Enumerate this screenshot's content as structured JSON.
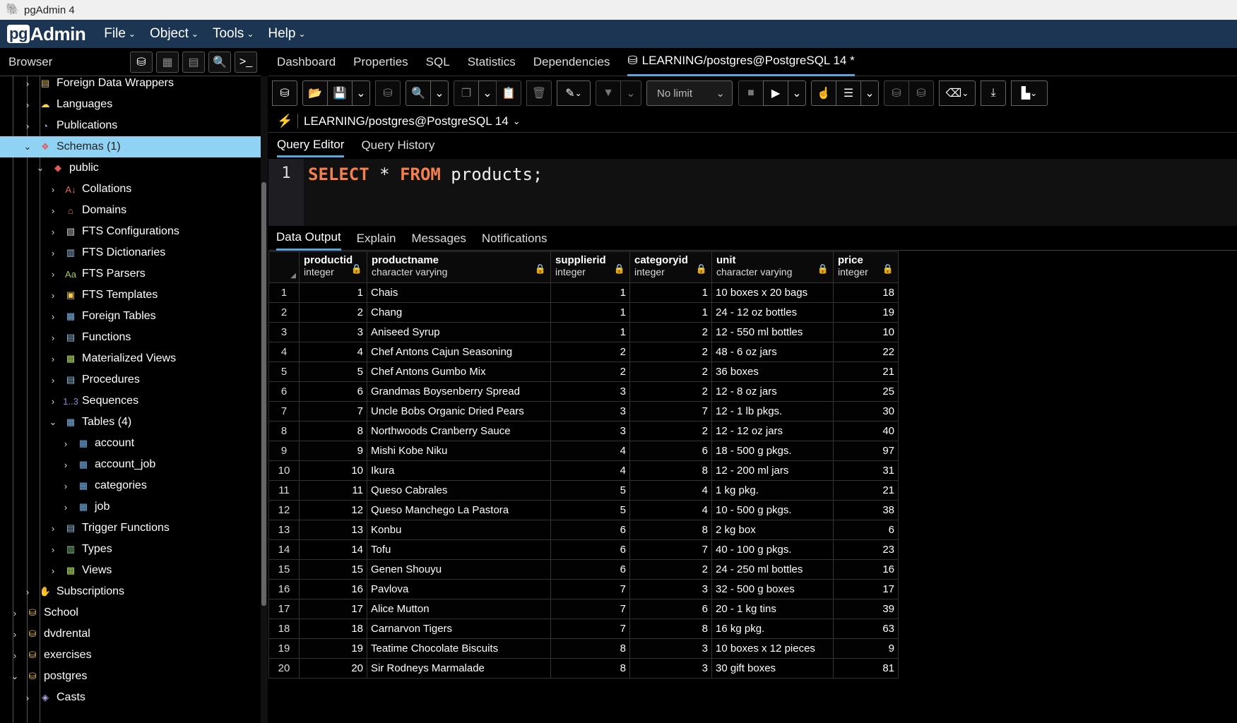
{
  "window": {
    "title": "pgAdmin 4"
  },
  "menubar": {
    "logo_pg": "pg",
    "logo_admin": "Admin",
    "items": [
      "File",
      "Object",
      "Tools",
      "Help"
    ]
  },
  "browser": {
    "title": "Browser",
    "tree": [
      {
        "label": "Foreign Data Wrappers",
        "indent": 2,
        "expanded": false,
        "icon": "foreign-data-wrapper-icon",
        "glyph": "▤",
        "color": "#e8c34a"
      },
      {
        "label": "Languages",
        "indent": 2,
        "expanded": false,
        "icon": "language-icon",
        "glyph": "☁",
        "color": "#f2d64b"
      },
      {
        "label": "Publications",
        "indent": 2,
        "expanded": false,
        "icon": "publication-icon",
        "glyph": "◔",
        "color": "#9fb6d9"
      },
      {
        "label": "Schemas (1)",
        "indent": 2,
        "expanded": true,
        "icon": "schemas-icon",
        "glyph": "❖",
        "color": "#e05a5a",
        "selected": true
      },
      {
        "label": "public",
        "indent": 3,
        "expanded": true,
        "icon": "schema-icon",
        "glyph": "◆",
        "color": "#e05a5a"
      },
      {
        "label": "Collations",
        "indent": 4,
        "expanded": false,
        "icon": "collation-icon",
        "glyph": "A↓",
        "color": "#e06b6b"
      },
      {
        "label": "Domains",
        "indent": 4,
        "expanded": false,
        "icon": "domain-icon",
        "glyph": "⌂",
        "color": "#e67a7a"
      },
      {
        "label": "FTS Configurations",
        "indent": 4,
        "expanded": false,
        "icon": "fts-configuration-icon",
        "glyph": "▧",
        "color": "#cccccc"
      },
      {
        "label": "FTS Dictionaries",
        "indent": 4,
        "expanded": false,
        "icon": "fts-dictionary-icon",
        "glyph": "▥",
        "color": "#9fc3e8"
      },
      {
        "label": "FTS Parsers",
        "indent": 4,
        "expanded": false,
        "icon": "fts-parser-icon",
        "glyph": "Aa",
        "color": "#a7c94a"
      },
      {
        "label": "FTS Templates",
        "indent": 4,
        "expanded": false,
        "icon": "fts-template-icon",
        "glyph": "▣",
        "color": "#f2c94b"
      },
      {
        "label": "Foreign Tables",
        "indent": 4,
        "expanded": false,
        "icon": "foreign-table-icon",
        "glyph": "▦",
        "color": "#7fb5e8"
      },
      {
        "label": "Functions",
        "indent": 4,
        "expanded": false,
        "icon": "function-icon",
        "glyph": "▤",
        "color": "#8fc3e0"
      },
      {
        "label": "Materialized Views",
        "indent": 4,
        "expanded": false,
        "icon": "materialized-view-icon",
        "glyph": "▩",
        "color": "#a8d65a"
      },
      {
        "label": "Procedures",
        "indent": 4,
        "expanded": false,
        "icon": "procedure-icon",
        "glyph": "▤",
        "color": "#8fc3e0"
      },
      {
        "label": "Sequences",
        "indent": 4,
        "expanded": false,
        "icon": "sequence-icon",
        "glyph": "1..3",
        "color": "#8a8ad0"
      },
      {
        "label": "Tables (4)",
        "indent": 4,
        "expanded": true,
        "icon": "tables-icon",
        "glyph": "▦",
        "color": "#7fb5e8"
      },
      {
        "label": "account",
        "indent": 5,
        "expanded": false,
        "icon": "table-icon",
        "glyph": "▦",
        "color": "#6fb0ea"
      },
      {
        "label": "account_job",
        "indent": 5,
        "expanded": false,
        "icon": "table-icon",
        "glyph": "▦",
        "color": "#6fb0ea"
      },
      {
        "label": "categories",
        "indent": 5,
        "expanded": false,
        "icon": "table-icon",
        "glyph": "▦",
        "color": "#6fb0ea"
      },
      {
        "label": "job",
        "indent": 5,
        "expanded": false,
        "icon": "table-icon",
        "glyph": "▦",
        "color": "#6fb0ea"
      },
      {
        "label": "Trigger Functions",
        "indent": 4,
        "expanded": false,
        "icon": "trigger-function-icon",
        "glyph": "▤",
        "color": "#8fc3e0"
      },
      {
        "label": "Types",
        "indent": 4,
        "expanded": false,
        "icon": "type-icon",
        "glyph": "▥",
        "color": "#8fd69a"
      },
      {
        "label": "Views",
        "indent": 4,
        "expanded": false,
        "icon": "view-icon",
        "glyph": "▩",
        "color": "#a8d65a"
      },
      {
        "label": "Subscriptions",
        "indent": 2,
        "expanded": false,
        "icon": "subscription-icon",
        "glyph": "✋",
        "color": "#f2c94b"
      },
      {
        "label": "School",
        "indent": 1,
        "expanded": false,
        "icon": "database-icon",
        "glyph": "⛁",
        "color": "#e8c34a"
      },
      {
        "label": "dvdrental",
        "indent": 1,
        "expanded": false,
        "icon": "database-icon",
        "glyph": "⛁",
        "color": "#e8c34a"
      },
      {
        "label": "exercises",
        "indent": 1,
        "expanded": false,
        "icon": "database-icon",
        "glyph": "⛁",
        "color": "#e8c34a"
      },
      {
        "label": "postgres",
        "indent": 1,
        "expanded": true,
        "icon": "database-icon",
        "glyph": "⛁",
        "color": "#e8c34a"
      },
      {
        "label": "Casts",
        "indent": 2,
        "expanded": false,
        "icon": "cast-icon",
        "glyph": "◈",
        "color": "#b9a2e8"
      }
    ]
  },
  "main": {
    "tabs": [
      "Dashboard",
      "Properties",
      "SQL",
      "Statistics",
      "Dependencies"
    ],
    "active_tab": "LEARNING/postgres@PostgreSQL 14 *",
    "row_limit": "No limit",
    "connection": "LEARNING/postgres@PostgreSQL 14",
    "query_tabs": [
      "Query Editor",
      "Query History"
    ],
    "editor": {
      "line_number": "1",
      "kw1": "SELECT",
      "mid": " * ",
      "kw2": "FROM",
      "rest": " products;"
    },
    "output_tabs": [
      "Data Output",
      "Explain",
      "Messages",
      "Notifications"
    ]
  },
  "grid": {
    "columns": [
      {
        "name": "productid",
        "type": "integer"
      },
      {
        "name": "productname",
        "type": "character varying"
      },
      {
        "name": "supplierid",
        "type": "integer"
      },
      {
        "name": "categoryid",
        "type": "integer"
      },
      {
        "name": "unit",
        "type": "character varying"
      },
      {
        "name": "price",
        "type": "integer"
      }
    ],
    "rows": [
      [
        "1",
        "1",
        "Chais",
        "1",
        "1",
        "10 boxes x 20 bags",
        "18"
      ],
      [
        "2",
        "2",
        "Chang",
        "1",
        "1",
        "24 - 12 oz bottles",
        "19"
      ],
      [
        "3",
        "3",
        "Aniseed Syrup",
        "1",
        "2",
        "12 - 550 ml bottles",
        "10"
      ],
      [
        "4",
        "4",
        "Chef Antons Cajun Seasoning",
        "2",
        "2",
        "48 - 6 oz jars",
        "22"
      ],
      [
        "5",
        "5",
        "Chef Antons Gumbo Mix",
        "2",
        "2",
        "36 boxes",
        "21"
      ],
      [
        "6",
        "6",
        "Grandmas Boysenberry Spread",
        "3",
        "2",
        "12 - 8 oz jars",
        "25"
      ],
      [
        "7",
        "7",
        "Uncle Bobs Organic Dried Pears",
        "3",
        "7",
        "12 - 1 lb pkgs.",
        "30"
      ],
      [
        "8",
        "8",
        "Northwoods Cranberry Sauce",
        "3",
        "2",
        "12 - 12 oz jars",
        "40"
      ],
      [
        "9",
        "9",
        "Mishi Kobe Niku",
        "4",
        "6",
        "18 - 500 g pkgs.",
        "97"
      ],
      [
        "10",
        "10",
        "Ikura",
        "4",
        "8",
        "12 - 200 ml jars",
        "31"
      ],
      [
        "11",
        "11",
        "Queso Cabrales",
        "5",
        "4",
        "1 kg pkg.",
        "21"
      ],
      [
        "12",
        "12",
        "Queso Manchego La Pastora",
        "5",
        "4",
        "10 - 500 g pkgs.",
        "38"
      ],
      [
        "13",
        "13",
        "Konbu",
        "6",
        "8",
        "2 kg box",
        "6"
      ],
      [
        "14",
        "14",
        "Tofu",
        "6",
        "7",
        "40 - 100 g pkgs.",
        "23"
      ],
      [
        "15",
        "15",
        "Genen Shouyu",
        "6",
        "2",
        "24 - 250 ml bottles",
        "16"
      ],
      [
        "16",
        "16",
        "Pavlova",
        "7",
        "3",
        "32 - 500 g boxes",
        "17"
      ],
      [
        "17",
        "17",
        "Alice Mutton",
        "7",
        "6",
        "20 - 1 kg tins",
        "39"
      ],
      [
        "18",
        "18",
        "Carnarvon Tigers",
        "7",
        "8",
        "16 kg pkg.",
        "63"
      ],
      [
        "19",
        "19",
        "Teatime Chocolate Biscuits",
        "8",
        "3",
        "10 boxes x 12 pieces",
        "9"
      ],
      [
        "20",
        "20",
        "Sir Rodneys Marmalade",
        "8",
        "3",
        "30 gift boxes",
        "81"
      ]
    ]
  }
}
